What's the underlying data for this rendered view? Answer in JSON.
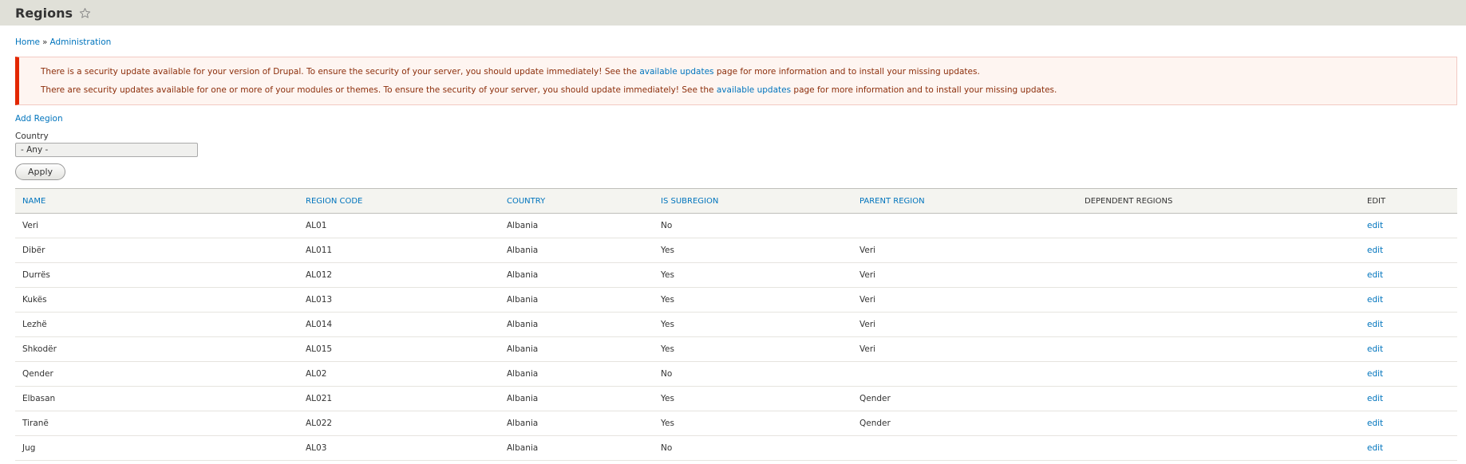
{
  "header": {
    "title": "Regions",
    "star_icon": "star-outline-icon"
  },
  "breadcrumb": {
    "home": "Home",
    "separator": "»",
    "admin": "Administration"
  },
  "messages": [
    {
      "before": "There is a security update available for your version of Drupal. To ensure the security of your server, you should update immediately! See the ",
      "link": "available updates",
      "after": " page for more information and to install your missing updates."
    },
    {
      "before": "There are security updates available for one or more of your modules or themes. To ensure the security of your server, you should update immediately! See the ",
      "link": "available updates",
      "after": " page for more information and to install your missing updates."
    }
  ],
  "actions": {
    "add_region": "Add Region"
  },
  "filter": {
    "label": "Country",
    "selected": "- Any -",
    "apply_label": "Apply"
  },
  "table": {
    "headers": [
      "NAME",
      "REGION CODE",
      "COUNTRY",
      "IS SUBREGION",
      "PARENT REGION",
      "DEPENDENT REGIONS",
      "EDIT"
    ],
    "rows": [
      [
        "Veri",
        "AL01",
        "Albania",
        "No",
        "",
        "",
        "edit"
      ],
      [
        "Dibër",
        "AL011",
        "Albania",
        "Yes",
        "Veri",
        "",
        "edit"
      ],
      [
        "Durrës",
        "AL012",
        "Albania",
        "Yes",
        "Veri",
        "",
        "edit"
      ],
      [
        "Kukës",
        "AL013",
        "Albania",
        "Yes",
        "Veri",
        "",
        "edit"
      ],
      [
        "Lezhë",
        "AL014",
        "Albania",
        "Yes",
        "Veri",
        "",
        "edit"
      ],
      [
        "Shkodër",
        "AL015",
        "Albania",
        "Yes",
        "Veri",
        "",
        "edit"
      ],
      [
        "Qender",
        "AL02",
        "Albania",
        "No",
        "",
        "",
        "edit"
      ],
      [
        "Elbasan",
        "AL021",
        "Albania",
        "Yes",
        "Qender",
        "",
        "edit"
      ],
      [
        "Tiranë",
        "AL022",
        "Albania",
        "Yes",
        "Qender",
        "",
        "edit"
      ],
      [
        "Jug",
        "AL03",
        "Albania",
        "No",
        "",
        "",
        "edit"
      ]
    ]
  },
  "colors": {
    "link": "#0074bd",
    "error_border": "#e32700",
    "error_bg": "#fef5f1",
    "error_text": "#8c2e0b",
    "header_bg": "#e0e0d8"
  }
}
